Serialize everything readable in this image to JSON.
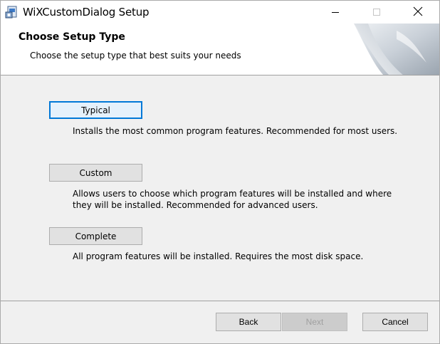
{
  "window": {
    "title": "WiXCustomDialog Setup",
    "controls": {
      "minimize_icon": "minimize-icon",
      "maximize_icon": "maximize-icon",
      "close_icon": "close-icon"
    }
  },
  "header": {
    "title": "Choose Setup Type",
    "description": "Choose the setup type that best suits your needs",
    "banner_icon": "page-curl-banner"
  },
  "options": [
    {
      "label": "Typical",
      "description": "Installs the most common program features. Recommended for most users.",
      "focused": true
    },
    {
      "label": "Custom",
      "description": "Allows users to choose which program features will be installed and where they will be installed. Recommended for advanced users.",
      "focused": false
    },
    {
      "label": "Complete",
      "description": "All program features will be installed. Requires the most disk space.",
      "focused": false
    }
  ],
  "footer": {
    "back_label": "Back",
    "next_label": "Next",
    "next_enabled": false,
    "cancel_label": "Cancel"
  },
  "colors": {
    "dialog_bg": "#f0f0f0",
    "header_bg": "#ffffff",
    "focus_accent": "#0078d7",
    "disabled_text": "#a0a0a0"
  }
}
